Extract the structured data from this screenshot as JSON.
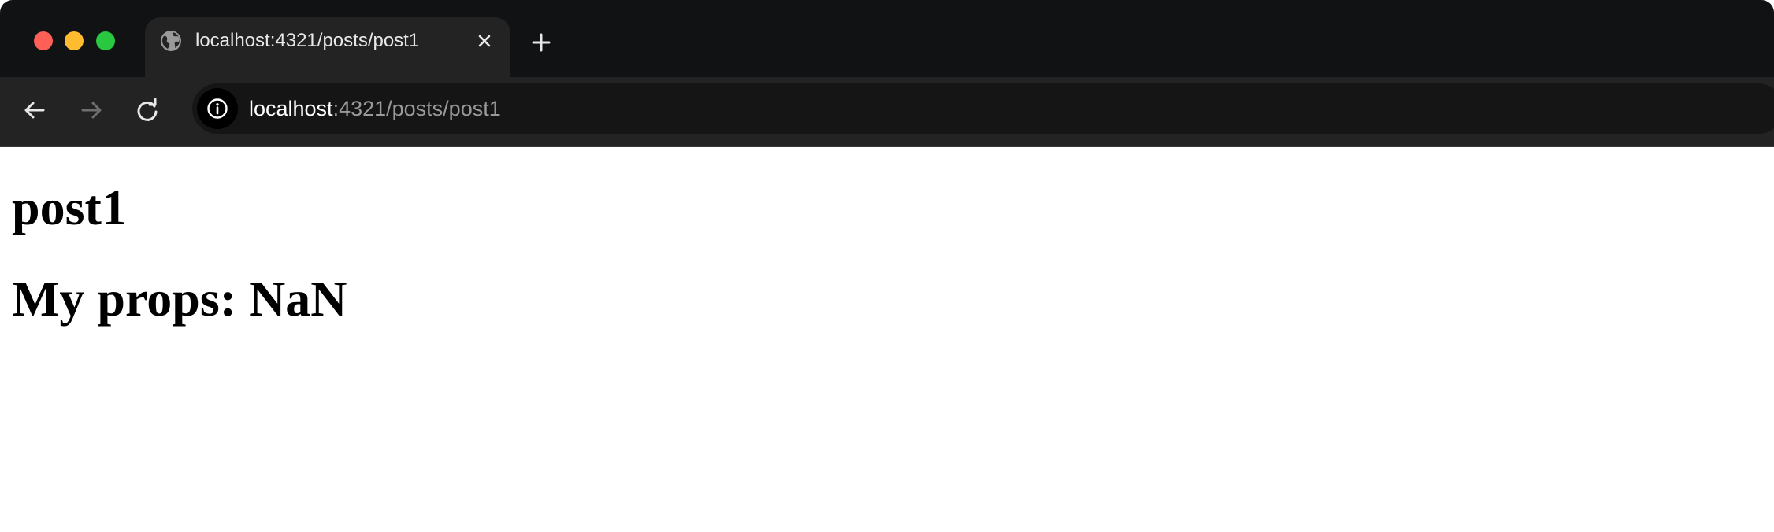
{
  "browser": {
    "tab": {
      "title": "localhost:4321/posts/post1",
      "favicon": "globe-icon",
      "close_icon": "close-icon"
    },
    "new_tab_icon": "plus-icon",
    "toolbar": {
      "back_icon": "arrow-left-icon",
      "forward_icon": "arrow-right-icon",
      "reload_icon": "reload-icon",
      "site_info_icon": "info-icon",
      "url_host": "localhost",
      "url_rest": ":4321/posts/post1"
    },
    "colors": {
      "frame": "#111213",
      "toolbar": "#232323",
      "omnibox": "#151515",
      "close_light": "#fe5f57",
      "minimize_light": "#febc2e",
      "maximize_light": "#28c840"
    }
  },
  "page": {
    "title": "post1",
    "props_line": "My props: NaN"
  }
}
